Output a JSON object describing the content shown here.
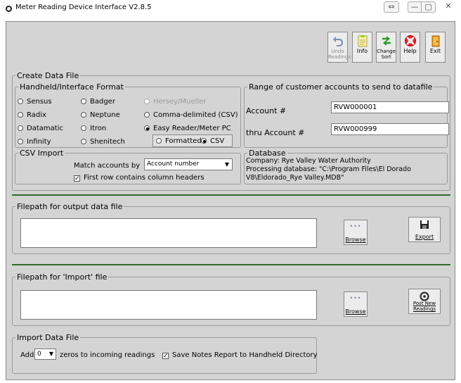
{
  "window": {
    "title": "Meter Reading Device Interface V2.8.5",
    "controls": {
      "resize": "⇔",
      "minimize": "—",
      "maximize": "▢",
      "close": "✕"
    }
  },
  "toolbar": {
    "undo": {
      "label": "Undo\nReadings",
      "icon": "undo-icon",
      "enabled": false
    },
    "info": {
      "label": "Info",
      "icon": "info-icon"
    },
    "change_sort": {
      "label": "Change\nSort",
      "icon": "sort-arrows-icon"
    },
    "help": {
      "label": "Help",
      "icon": "lifebuoy-icon"
    },
    "exit": {
      "label": "Exit",
      "icon": "exit-door-icon"
    }
  },
  "create_data_file": {
    "legend": "Create Data File",
    "format": {
      "legend": "Handheld/Interface Format",
      "options": [
        {
          "label": "Sensus",
          "selected": false,
          "enabled": true
        },
        {
          "label": "Badger",
          "selected": false,
          "enabled": true
        },
        {
          "label": "Hersey/Mueller",
          "selected": false,
          "enabled": false
        },
        {
          "label": "Radix",
          "selected": false,
          "enabled": true
        },
        {
          "label": "Neptune",
          "selected": false,
          "enabled": true
        },
        {
          "label": "Comma-delimited (CSV)",
          "selected": false,
          "enabled": true
        },
        {
          "label": "Datamatic",
          "selected": false,
          "enabled": true
        },
        {
          "label": "Itron",
          "selected": false,
          "enabled": true
        },
        {
          "label": "Easy Reader/Meter PC",
          "selected": true,
          "enabled": true
        },
        {
          "label": "Infinity",
          "selected": false,
          "enabled": true
        },
        {
          "label": "Shenitech",
          "selected": false,
          "enabled": true
        }
      ],
      "sub_options": [
        {
          "label": "Formatted",
          "selected": false
        },
        {
          "label": "CSV",
          "selected": true
        }
      ]
    },
    "range": {
      "legend": "Range of customer accounts to send to datafile",
      "account_label": "Account #",
      "account_value": "RVW000001",
      "thru_label": "thru Account #",
      "thru_value": "RVW000999"
    },
    "csv_import": {
      "legend": "CSV Import",
      "match_label": "Match accounts by",
      "match_value": "Account number",
      "first_row_label": "First row contains column headers",
      "first_row_checked": true
    },
    "database": {
      "legend": "Database",
      "company": "Company: Rye Valley Water Authority",
      "processing_line1": "Processing database: \"C:\\Program Files\\El Dorado",
      "processing_line2": "V8\\Eldorado_Rye Valley.MDB\""
    }
  },
  "output": {
    "legend": "Filepath for output data file",
    "value": "",
    "browse_label": "Browse",
    "export_label": "Export"
  },
  "import": {
    "legend": "Filepath for 'Import' file",
    "value": "",
    "browse_label": "Browse",
    "post_label": "Post New\nReadings"
  },
  "import_data_file": {
    "legend": "Import Data File",
    "add_label": "Add",
    "zeros_value": "0",
    "zeros_suffix": "zeros to incoming readings",
    "save_notes_label": "Save Notes Report to Handheld Directory",
    "save_notes_checked": true
  },
  "colors": {
    "panel": "#d4d4d4",
    "divider": "#2e6b2e"
  }
}
